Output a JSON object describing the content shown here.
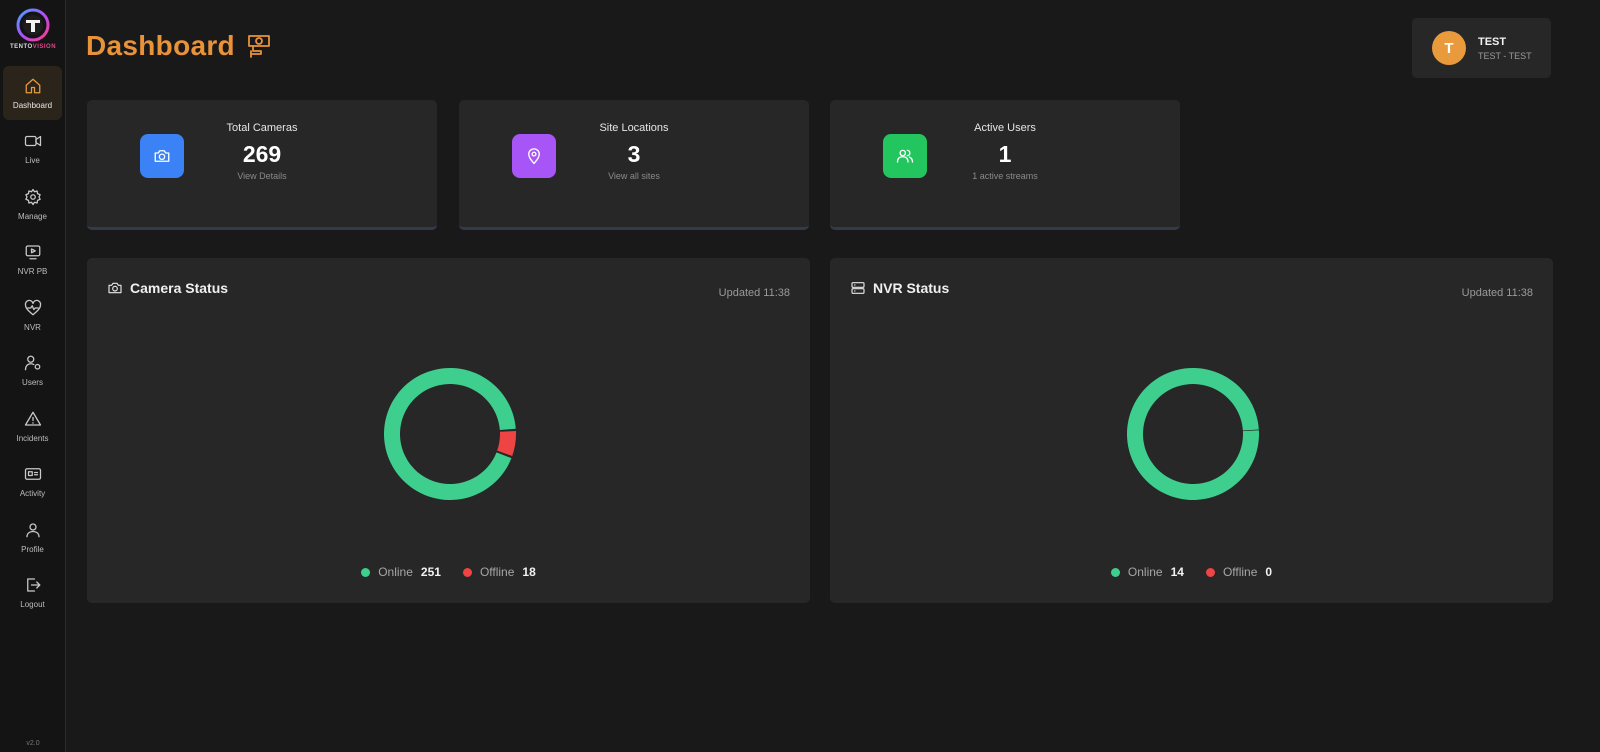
{
  "app": {
    "logo_text_a": "TENTO",
    "logo_text_b": "VISION",
    "version": "v2.0"
  },
  "sidebar": {
    "items": [
      {
        "label": "Dashboard",
        "icon": "home-icon",
        "active": true
      },
      {
        "label": "Live",
        "icon": "video-icon"
      },
      {
        "label": "Manage",
        "icon": "gear-icon"
      },
      {
        "label": "NVR PB",
        "icon": "play-screen-icon"
      },
      {
        "label": "NVR",
        "icon": "heart-pulse-icon"
      },
      {
        "label": "Users",
        "icon": "user-gear-icon"
      },
      {
        "label": "Incidents",
        "icon": "warning-icon"
      },
      {
        "label": "Activity",
        "icon": "activity-card-icon"
      },
      {
        "label": "Profile",
        "icon": "profile-icon"
      },
      {
        "label": "Logout",
        "icon": "logout-icon"
      }
    ]
  },
  "header": {
    "title": "Dashboard",
    "title_icon": "cctv-camera-icon"
  },
  "user": {
    "initial": "T",
    "name": "TEST",
    "sub": "TEST - TEST"
  },
  "stats": [
    {
      "label": "Total Cameras",
      "value": "269",
      "sub": "View Details",
      "icon": "camera-icon",
      "color": "#3b82f6"
    },
    {
      "label": "Site Locations",
      "value": "3",
      "sub": "View all sites",
      "icon": "location-pin-icon",
      "color": "#a855f7"
    },
    {
      "label": "Active Users",
      "value": "1",
      "sub": "1 active streams",
      "icon": "users-icon",
      "color": "#22c55e"
    }
  ],
  "colors": {
    "accent": "#e8923a",
    "online": "#3ecf8e",
    "offline": "#ef4444"
  },
  "camera_status": {
    "title": "Camera Status",
    "updated": "Updated 11:38",
    "online_label": "Online",
    "online_value": 251,
    "offline_label": "Offline",
    "offline_value": 18
  },
  "nvr_status": {
    "title": "NVR Status",
    "updated": "Updated 11:38",
    "online_label": "Online",
    "online_value": 14,
    "offline_label": "Offline",
    "offline_value": 0
  }
}
